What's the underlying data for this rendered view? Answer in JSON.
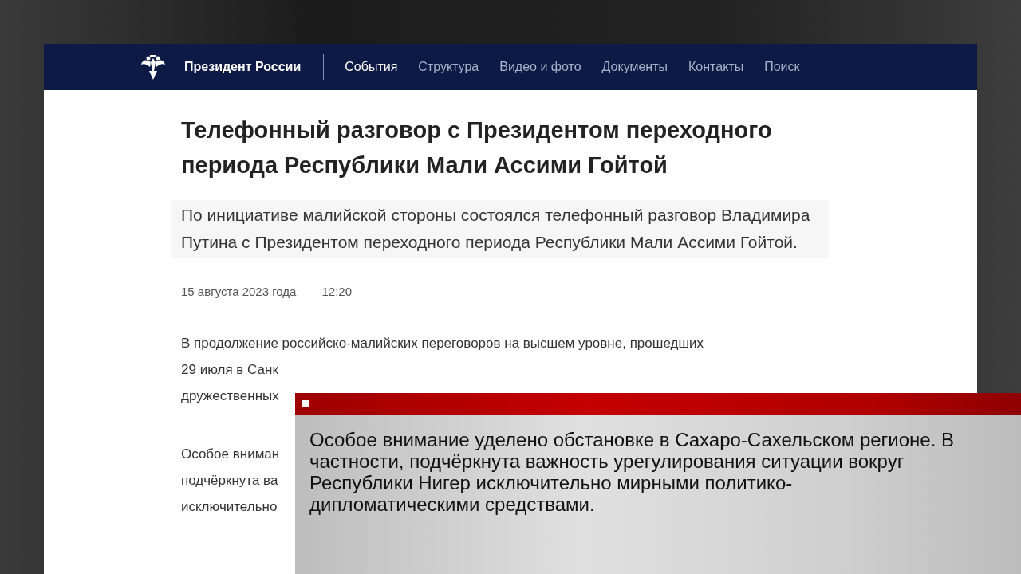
{
  "site": {
    "name": "Президент России"
  },
  "nav": [
    {
      "label": "События",
      "selected": true
    },
    {
      "label": "Структура",
      "selected": false
    },
    {
      "label": "Видео и фото",
      "selected": false
    },
    {
      "label": "Документы",
      "selected": false
    },
    {
      "label": "Контакты",
      "selected": false
    },
    {
      "label": "Поиск",
      "selected": false
    }
  ],
  "article": {
    "title": "Телефонный разговор с Президентом переходного периода Республики Мали Ассими Гойтой",
    "lead": "По инициативе малийской стороны состоялся телефонный разговор Владимира Путина с Президентом переходного периода Республики Мали Ассими Гойтой.",
    "date": "15 августа 2023 года",
    "time": "12:20",
    "paragraphs": [
      [
        "В продолжение российско-малийских переговоров на высшем уровне, прошедших",
        "29 июля в Санк",
        "дружественных"
      ],
      [
        "Особое вниман",
        "подчёркнута ва",
        "исключительно"
      ]
    ]
  },
  "caption": {
    "text": "Особое внимание уделено обстановке в Сахаро-Сахельском регионе. В частности, подчёркнута важность урегулирования ситуации вокруг Республики Нигер исключительно мирными политико-дипломатическими средствами."
  }
}
